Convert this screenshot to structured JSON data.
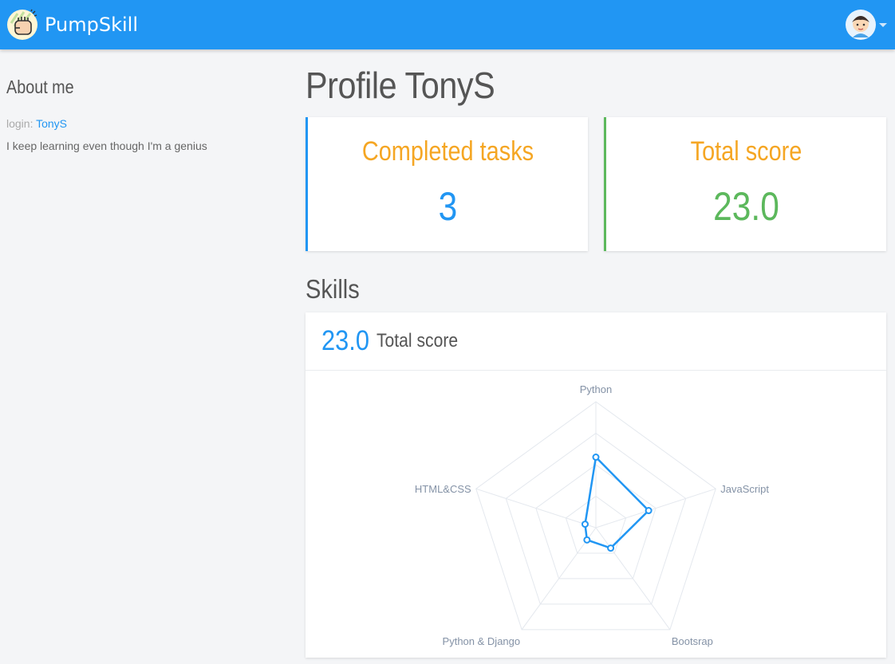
{
  "app": {
    "name": "PumpSkill",
    "logo_icon": "fist-logo-icon",
    "avatar_icon": "user-avatar-icon"
  },
  "sidebar": {
    "heading": "About me",
    "login_prefix": "login:",
    "login_value": "TonyS",
    "bio": "I keep learning even though I'm a genius"
  },
  "main": {
    "title": "Profile TonyS",
    "stats": [
      {
        "label": "Completed tasks",
        "value": "3",
        "color": "#2196f3"
      },
      {
        "label": "Total score",
        "value": "23.0",
        "color": "#5cb85c"
      }
    ],
    "skills_heading": "Skills",
    "skills_card": {
      "score": "23.0",
      "score_label": "Total score"
    }
  },
  "chart_data": {
    "type": "radar",
    "categories": [
      "Python",
      "JavaScript",
      "Bootsrap",
      "Python & Django",
      "HTML&CSS"
    ],
    "series": [
      {
        "values": [
          0.56,
          0.44,
          0.2,
          0.12,
          0.09
        ]
      }
    ],
    "range": [
      0,
      1
    ],
    "rings": 4,
    "color": "#2196f3",
    "grid": true
  },
  "colors": {
    "navbar": "#2196f3",
    "accent_orange": "#f5a623",
    "green": "#5cb85c",
    "blue": "#2196f3"
  }
}
